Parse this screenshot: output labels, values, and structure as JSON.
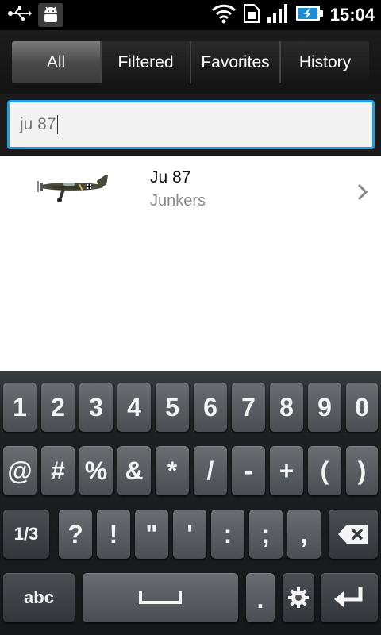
{
  "status_bar": {
    "time": "15:04"
  },
  "tabs": [
    {
      "label": "All",
      "active": true
    },
    {
      "label": "Filtered",
      "active": false
    },
    {
      "label": "Favorites",
      "active": false
    },
    {
      "label": "History",
      "active": false
    }
  ],
  "search": {
    "value": "ju 87"
  },
  "results": [
    {
      "title": "Ju 87",
      "subtitle": "Junkers"
    }
  ],
  "keyboard": {
    "row1": [
      "1",
      "2",
      "3",
      "4",
      "5",
      "6",
      "7",
      "8",
      "9",
      "0"
    ],
    "row2": [
      "@",
      "#",
      "%",
      "&",
      "*",
      "/",
      "-",
      "+",
      "(",
      ")"
    ],
    "row3_shift": "1/3",
    "row3": [
      "?",
      "!",
      "\"",
      "'",
      ":",
      ";",
      ","
    ],
    "abc_label": "abc",
    "period": "."
  },
  "colors": {
    "accent": "#1aa0e8",
    "active_tab": "#5a5a5a"
  }
}
